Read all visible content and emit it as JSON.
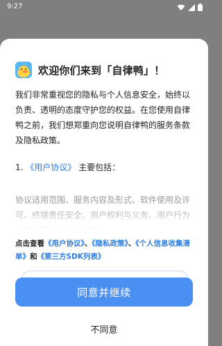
{
  "status_bar": {
    "time": "9:27"
  },
  "dialog": {
    "title": "欢迎你们来到「自律鸭」！",
    "intro": "我们非常重视您的隐私与个人信息安全，始终以负责、透明的态度守护您的权益。在您使用自律鸭之前，我们想郑重向您说明自律鸭的服务条款及隐私政策。",
    "section": {
      "number": "1.",
      "link": "《用户协议》",
      "suffix": "主要包括："
    },
    "section_body": "协议适用范围、服务内容及形式、软件使用及许可、终端责任安全、用户权利与义务、用户行为规范、用户信息保护等。",
    "consent": {
      "prefix": "点击查看",
      "link1": "《用户协议》",
      "sep1": "、",
      "link2": "《隐私政策》",
      "sep2": "、",
      "link3": "《个人信息收集清单》",
      "and": "和",
      "link4": "《第三方SDK列表》"
    },
    "agree_label": "同意并继续",
    "disagree_label": "不同意"
  },
  "colors": {
    "accent": "#4a8ff2",
    "link": "#2d7de0",
    "logo_bg": "#5bb7f0"
  },
  "icons": [
    "wifi-icon",
    "signal-icon",
    "battery-icon",
    "duck-logo-icon"
  ]
}
